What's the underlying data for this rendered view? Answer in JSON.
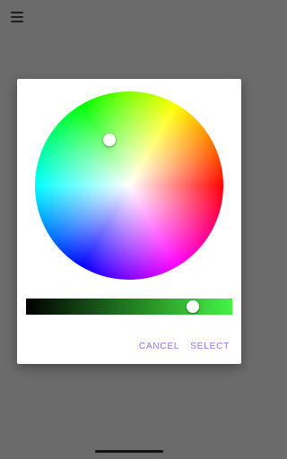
{
  "app_bar": {
    "menu_icon": "menu-icon"
  },
  "color_picker": {
    "selected_color": "#43f543",
    "brightness": 0.81,
    "actions": {
      "cancel_label": "CANCEL",
      "select_label": "SELECT"
    }
  }
}
